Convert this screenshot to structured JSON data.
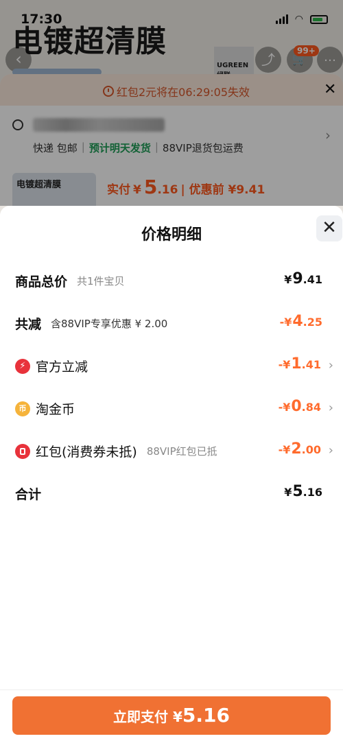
{
  "status_bar": {
    "time": "17:30"
  },
  "background": {
    "big_title": "电镀超清膜",
    "nav": {
      "back_icon": "‹",
      "cart_badge": "99+",
      "brand": "UGREEN 绿联"
    },
    "coupon_banner": "红包2元将在06:29:05失效",
    "shipping": {
      "express": "快递 包邮",
      "sep": "|",
      "eta": "预计明天发货",
      "vip": "88VIP退货包运费"
    },
    "product": {
      "thumb_label": "电镀超清膜",
      "actual_label": "实付",
      "actual_yen": "¥",
      "actual_int": "5",
      "actual_dec": ".16",
      "before_label": "| 优惠前 ¥9.41"
    }
  },
  "sheet": {
    "title": "价格明细",
    "rows": {
      "total": {
        "label": "商品总价",
        "sub": "共1件宝贝",
        "yen": "¥",
        "int": "9",
        "dec": ".41"
      },
      "reduce": {
        "label": "共减",
        "sub": "含88VIP专享优惠 ¥ 2.00",
        "yen": "-¥",
        "int": "4",
        "dec": ".25"
      },
      "official": {
        "label": "官方立减",
        "icon": "lightning-icon",
        "yen": "-¥",
        "int": "1",
        "dec": ".41"
      },
      "coins": {
        "label": "淘金币",
        "icon": "coin-icon",
        "yen": "-¥",
        "int": "0",
        "dec": ".84"
      },
      "redpack": {
        "label": "红包(消费券未抵)",
        "sub": "88VIP红包已抵",
        "icon": "red-packet-icon",
        "yen": "-¥",
        "int": "2",
        "dec": ".00"
      },
      "sum": {
        "label": "合计",
        "yen": "¥",
        "int": "5",
        "dec": ".16"
      }
    },
    "pay_button": {
      "label": "立即支付",
      "yen": "¥",
      "amount": "5.16"
    }
  },
  "colors": {
    "accent": "#f07133",
    "discount": "#ff6b2d",
    "green": "#1f9e58"
  }
}
